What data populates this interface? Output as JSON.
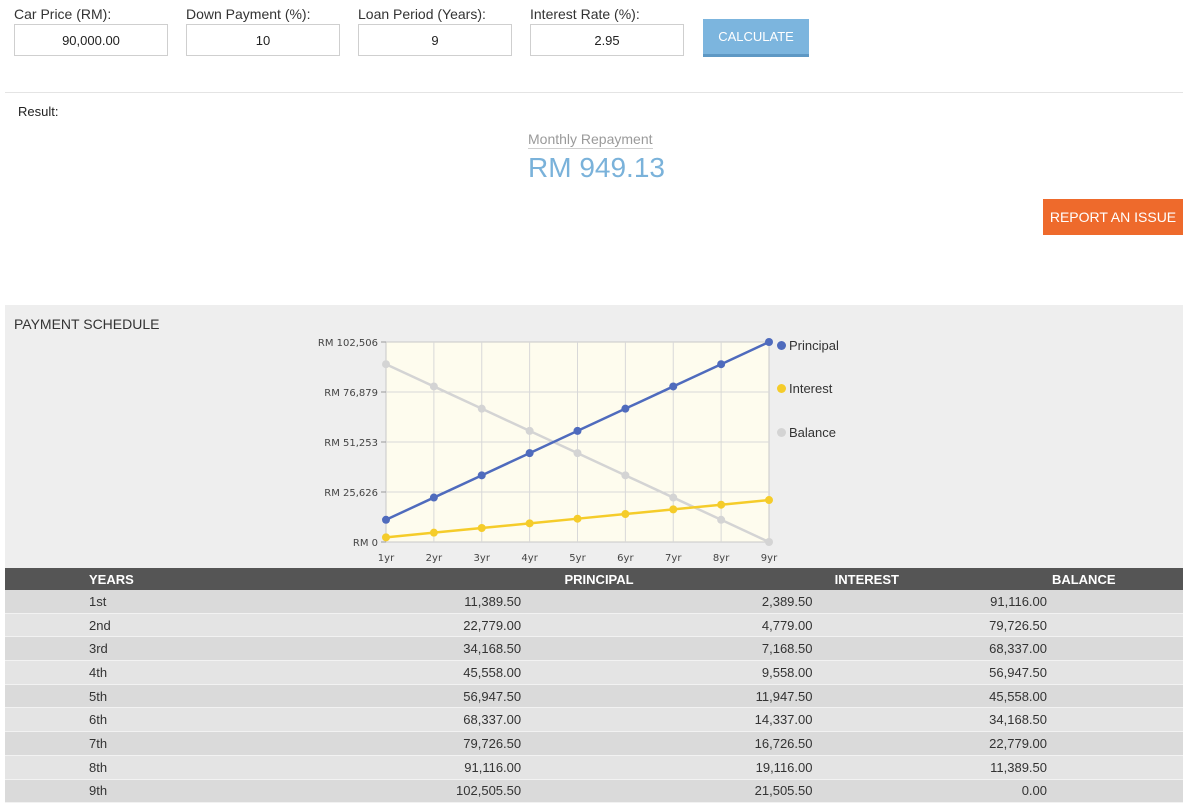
{
  "form": {
    "car_price": {
      "label": "Car Price (RM):",
      "value": "90,000.00"
    },
    "down_payment": {
      "label": "Down Payment (%):",
      "value": "10"
    },
    "loan_period": {
      "label": "Loan Period (Years):",
      "value": "9"
    },
    "interest_rate": {
      "label": "Interest Rate (%):",
      "value": "2.95"
    },
    "calculate_label": "CALCULATE"
  },
  "result": {
    "label": "Result:",
    "caption": "Monthly Repayment",
    "amount": "RM 949.13",
    "report_label": "REPORT AN ISSUE"
  },
  "schedule": {
    "title": "PAYMENT SCHEDULE",
    "headers": [
      "YEARS",
      "PRINCIPAL",
      "INTEREST",
      "BALANCE"
    ],
    "rows": [
      [
        "1st",
        "11,389.50",
        "2,389.50",
        "91,116.00"
      ],
      [
        "2nd",
        "22,779.00",
        "4,779.00",
        "79,726.50"
      ],
      [
        "3rd",
        "34,168.50",
        "7,168.50",
        "68,337.00"
      ],
      [
        "4th",
        "45,558.00",
        "9,558.00",
        "56,947.50"
      ],
      [
        "5th",
        "56,947.50",
        "11,947.50",
        "45,558.00"
      ],
      [
        "6th",
        "68,337.00",
        "14,337.00",
        "34,168.50"
      ],
      [
        "7th",
        "79,726.50",
        "16,726.50",
        "22,779.00"
      ],
      [
        "8th",
        "91,116.00",
        "19,116.00",
        "11,389.50"
      ],
      [
        "9th",
        "102,505.50",
        "21,505.50",
        "0.00"
      ]
    ]
  },
  "chart_data": {
    "type": "line",
    "x": [
      "1yr",
      "2yr",
      "3yr",
      "4yr",
      "5yr",
      "6yr",
      "7yr",
      "8yr",
      "9yr"
    ],
    "yticks": [
      "RM 0",
      "RM 25,626",
      "RM 51,253",
      "RM 76,879",
      "RM 102,506"
    ],
    "ylim": [
      0,
      102506
    ],
    "grid": true,
    "legend_position": "right",
    "series": [
      {
        "name": "Principal",
        "color": "#4f6bbd",
        "values": [
          11389.5,
          22779,
          34168.5,
          45558,
          56947.5,
          68337,
          79726.5,
          91116,
          102505.5
        ]
      },
      {
        "name": "Interest",
        "color": "#f5cc2a",
        "values": [
          2389.5,
          4779,
          7168.5,
          9558,
          11947.5,
          14337,
          16726.5,
          19116,
          21505.5
        ]
      },
      {
        "name": "Balance",
        "color": "#d4d4d4",
        "values": [
          91116,
          79726.5,
          68337,
          56947.5,
          45558,
          34168.5,
          22779,
          11389.5,
          0
        ]
      }
    ]
  }
}
